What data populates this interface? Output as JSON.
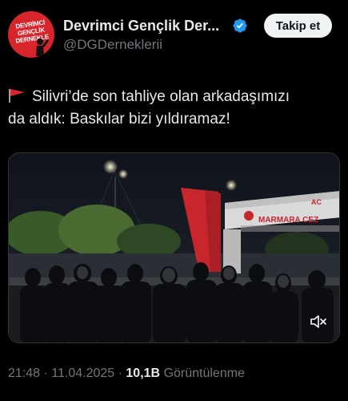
{
  "profile": {
    "avatar_lines": [
      "DEVRİMCİ",
      "GENÇLİK",
      "DERNEKLE"
    ],
    "display_name": "Devrimci Gençlik Der...",
    "handle": "@DGDerneklerii",
    "follow_label": "Takip et"
  },
  "tweet": {
    "line1": "Silivri’de son tahliye olan arkadaşımızı",
    "line2": "da aldık: Baskılar bizi yıldıramaz!",
    "flag_icon": "triangular-red-flag-icon"
  },
  "media": {
    "sign_text": "MARMARA CEZ",
    "sign_letters_top": "AC",
    "mute_icon": "speaker-muted-icon"
  },
  "meta": {
    "time": "21:48",
    "separator": "·",
    "date": "11.04.2025",
    "views_count": "10,1B",
    "views_label": "Görüntülenme"
  },
  "colors": {
    "background": "#000000",
    "text_primary": "#e7e9ea",
    "text_secondary": "#71767b",
    "verified_blue": "#1d9bf0",
    "avatar_red": "#d8252c",
    "flag_red": "#e0242f"
  }
}
